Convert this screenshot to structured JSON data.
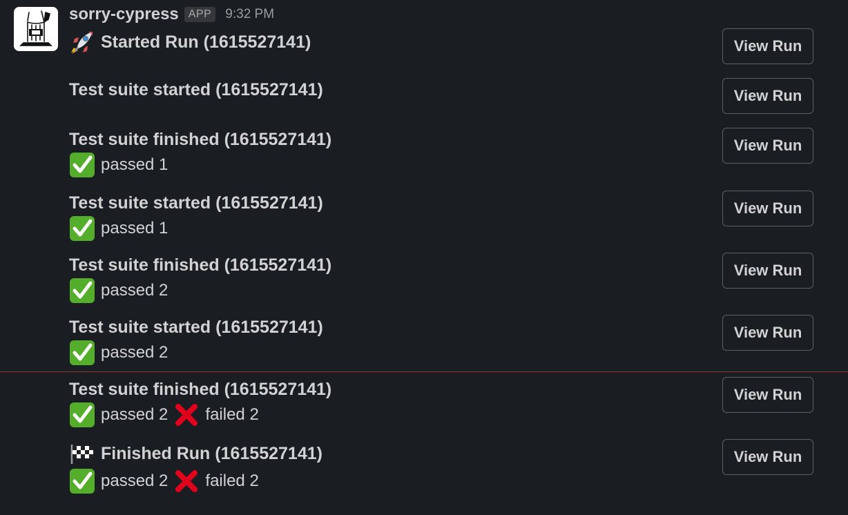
{
  "message": {
    "app_name": "sorry-cypress",
    "app_badge": "APP",
    "timestamp": "9:32 PM"
  },
  "messages": [
    {
      "icon": "rocket",
      "title": "Started Run (1615527141)",
      "button": "View Run"
    },
    {
      "title": "Test suite started (1615527141)",
      "button": "View Run"
    },
    {
      "title": "Test suite finished (1615527141)",
      "passed": "passed 1",
      "button": "View Run"
    },
    {
      "title": "Test suite started (1615527141)",
      "passed": "passed 1",
      "button": "View Run"
    },
    {
      "title": "Test suite finished (1615527141)",
      "passed": "passed 2",
      "button": "View Run"
    },
    {
      "title": "Test suite started (1615527141)",
      "passed": "passed 2",
      "button": "View Run"
    },
    {
      "title": "Test suite finished (1615527141)",
      "passed": "passed 2",
      "failed": "failed 2",
      "button": "View Run"
    },
    {
      "icon": "checkered-flag",
      "title": "Finished Run (1615527141)",
      "passed": "passed 2",
      "failed": "failed 2",
      "button": "View Run"
    }
  ],
  "icons": {
    "avatar": "tree-stump-axe-logo",
    "passed": "check-mark-button-icon",
    "failed": "cross-mark-icon"
  },
  "colors": {
    "background": "#1a1d21",
    "text": "#d1d2d3",
    "check_green": "#55ae2b",
    "cross_red": "#e0001b",
    "new_divider": "#8c3a2f"
  }
}
